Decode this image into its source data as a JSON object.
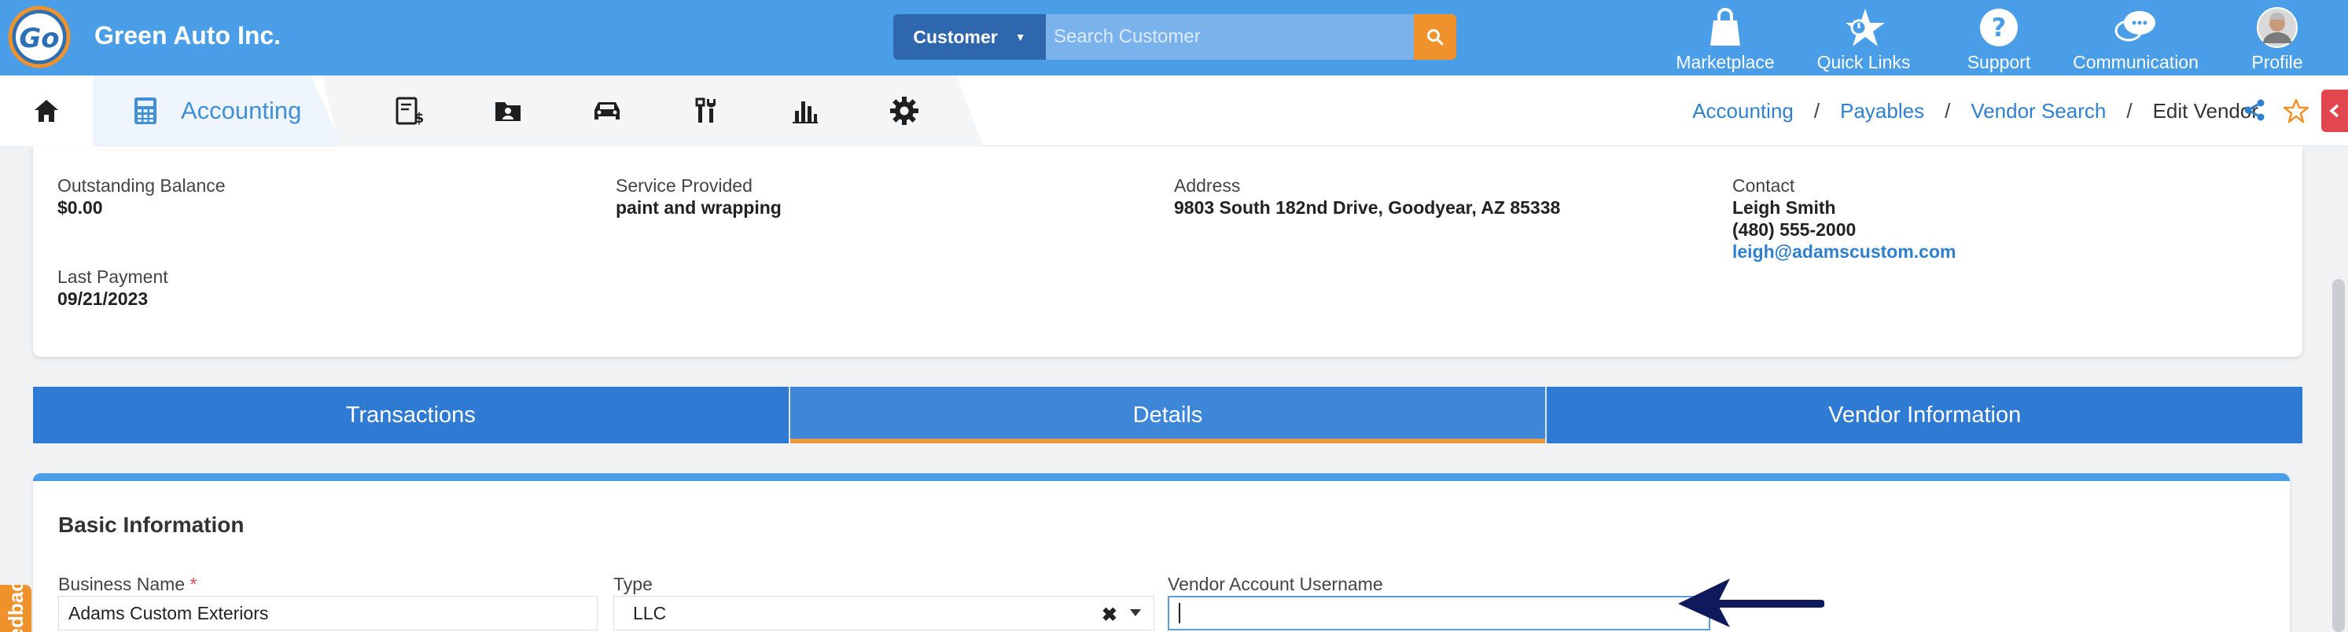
{
  "header": {
    "app_name": "Green Auto Inc.",
    "logo_text": "Go",
    "search": {
      "category": "Customer",
      "placeholder": "Search Customer"
    },
    "nav": [
      {
        "label": "Marketplace",
        "icon": "shopping-bag-icon"
      },
      {
        "label": "Quick Links",
        "icon": "star-link-icon"
      },
      {
        "label": "Support",
        "icon": "question-icon"
      },
      {
        "label": "Communication",
        "icon": "chat-icon"
      },
      {
        "label": "Profile",
        "icon": "avatar"
      }
    ]
  },
  "module_bar": {
    "active_module": "Accounting",
    "icons": [
      "home-icon",
      "calculator-icon",
      "invoice-icon",
      "contacts-icon",
      "car-icon",
      "tools-icon",
      "bar-chart-icon",
      "gear-icon"
    ],
    "breadcrumb": {
      "items": [
        "Accounting",
        "Payables",
        "Vendor Search"
      ],
      "separator": "/",
      "current": "Edit Vendor"
    }
  },
  "summary": {
    "outstanding_balance": {
      "label": "Outstanding Balance",
      "value": "$0.00"
    },
    "service_provided": {
      "label": "Service Provided",
      "value": "paint and wrapping"
    },
    "address": {
      "label": "Address",
      "value": "9803 South 182nd Drive, Goodyear, AZ 85338"
    },
    "contact": {
      "label": "Contact",
      "name": "Leigh Smith",
      "phone": "(480) 555-2000",
      "email": "leigh@adamscustom.com"
    },
    "last_payment": {
      "label": "Last Payment",
      "value": "09/21/2023"
    }
  },
  "tabs": [
    {
      "label": "Transactions",
      "active": false
    },
    {
      "label": "Details",
      "active": true
    },
    {
      "label": "Vendor Information",
      "active": false
    }
  ],
  "details": {
    "section_title": "Basic Information",
    "business_name": {
      "label": "Business Name",
      "required_mark": "*",
      "value": "Adams Custom Exteriors"
    },
    "type": {
      "label": "Type",
      "value": "LLC",
      "clear_glyph": "✖"
    },
    "vendor_account_username": {
      "label": "Vendor Account Username",
      "value": ""
    }
  },
  "feedback_tab": {
    "label": "Feedback!"
  },
  "colors": {
    "header_blue": "#4a9ee8",
    "tab_blue": "#2f7ad2",
    "accent_orange": "#f0922b",
    "link_blue": "#2f7fcf",
    "danger_red": "#e2474f"
  }
}
